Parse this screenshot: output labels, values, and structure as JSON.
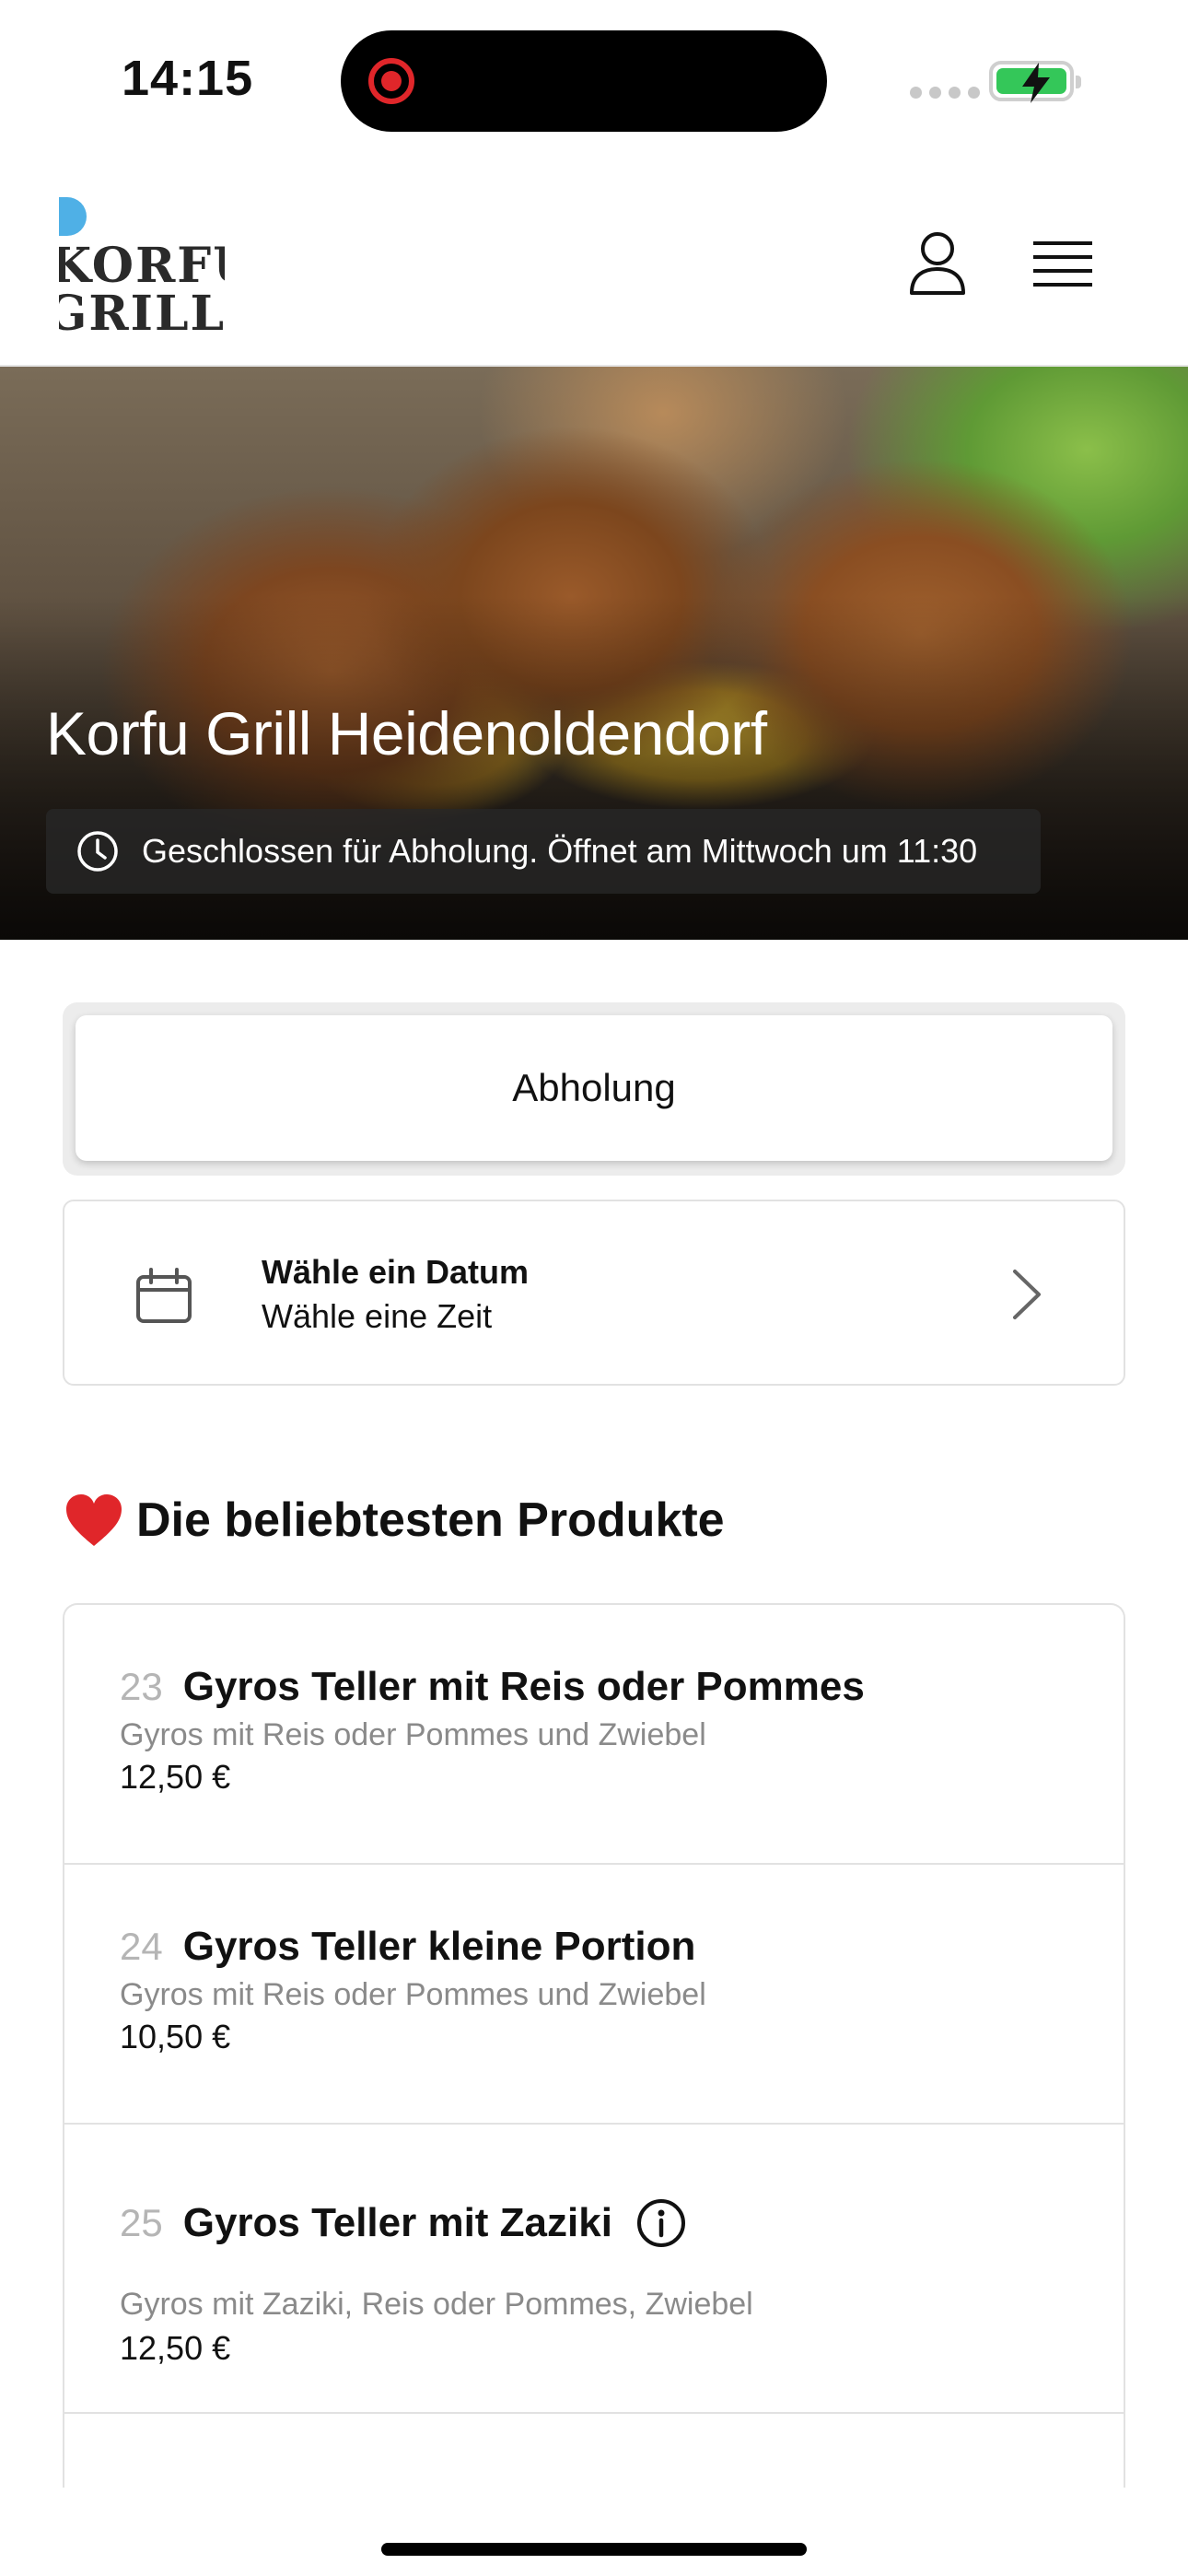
{
  "status_bar": {
    "time": "14:15"
  },
  "header": {
    "logo_text_line1": "KORFU",
    "logo_text_line2": "GRILL",
    "account_icon": "user-icon",
    "menu_icon": "hamburger-menu-icon"
  },
  "hero": {
    "title": "Korfu Grill Heidenoldendorf",
    "hours_status": "Geschlossen für Abholung. Öffnet am Mittwoch um 11:30",
    "hours_icon": "clock-icon"
  },
  "order_mode": {
    "selected_label": "Abholung"
  },
  "schedule": {
    "date_label": "Wähle ein Datum",
    "time_label": "Wähle eine Zeit",
    "icon": "calendar-icon"
  },
  "popular": {
    "title": "Die beliebtesten Produkte",
    "icon": "heart-icon",
    "items": [
      {
        "number": "23",
        "name": "Gyros Teller mit Reis oder Pommes",
        "description": "Gyros mit Reis oder Pommes und Zwiebel",
        "price": "12,50 €"
      },
      {
        "number": "24",
        "name": "Gyros Teller kleine Portion",
        "description": "Gyros mit Reis oder Pommes und Zwiebel",
        "price": "10,50 €"
      },
      {
        "number": "25",
        "name": "Gyros Teller mit Zaziki",
        "description": "Gyros mit Zaziki, Reis oder Pommes, Zwiebel",
        "price": "12,50 €",
        "icon": "info-icon"
      }
    ]
  },
  "colors": {
    "battery_green": "#34c759",
    "recording_red": "#e0262a",
    "heart_red": "#e0262a",
    "logo_blue": "#4fb0e6"
  }
}
